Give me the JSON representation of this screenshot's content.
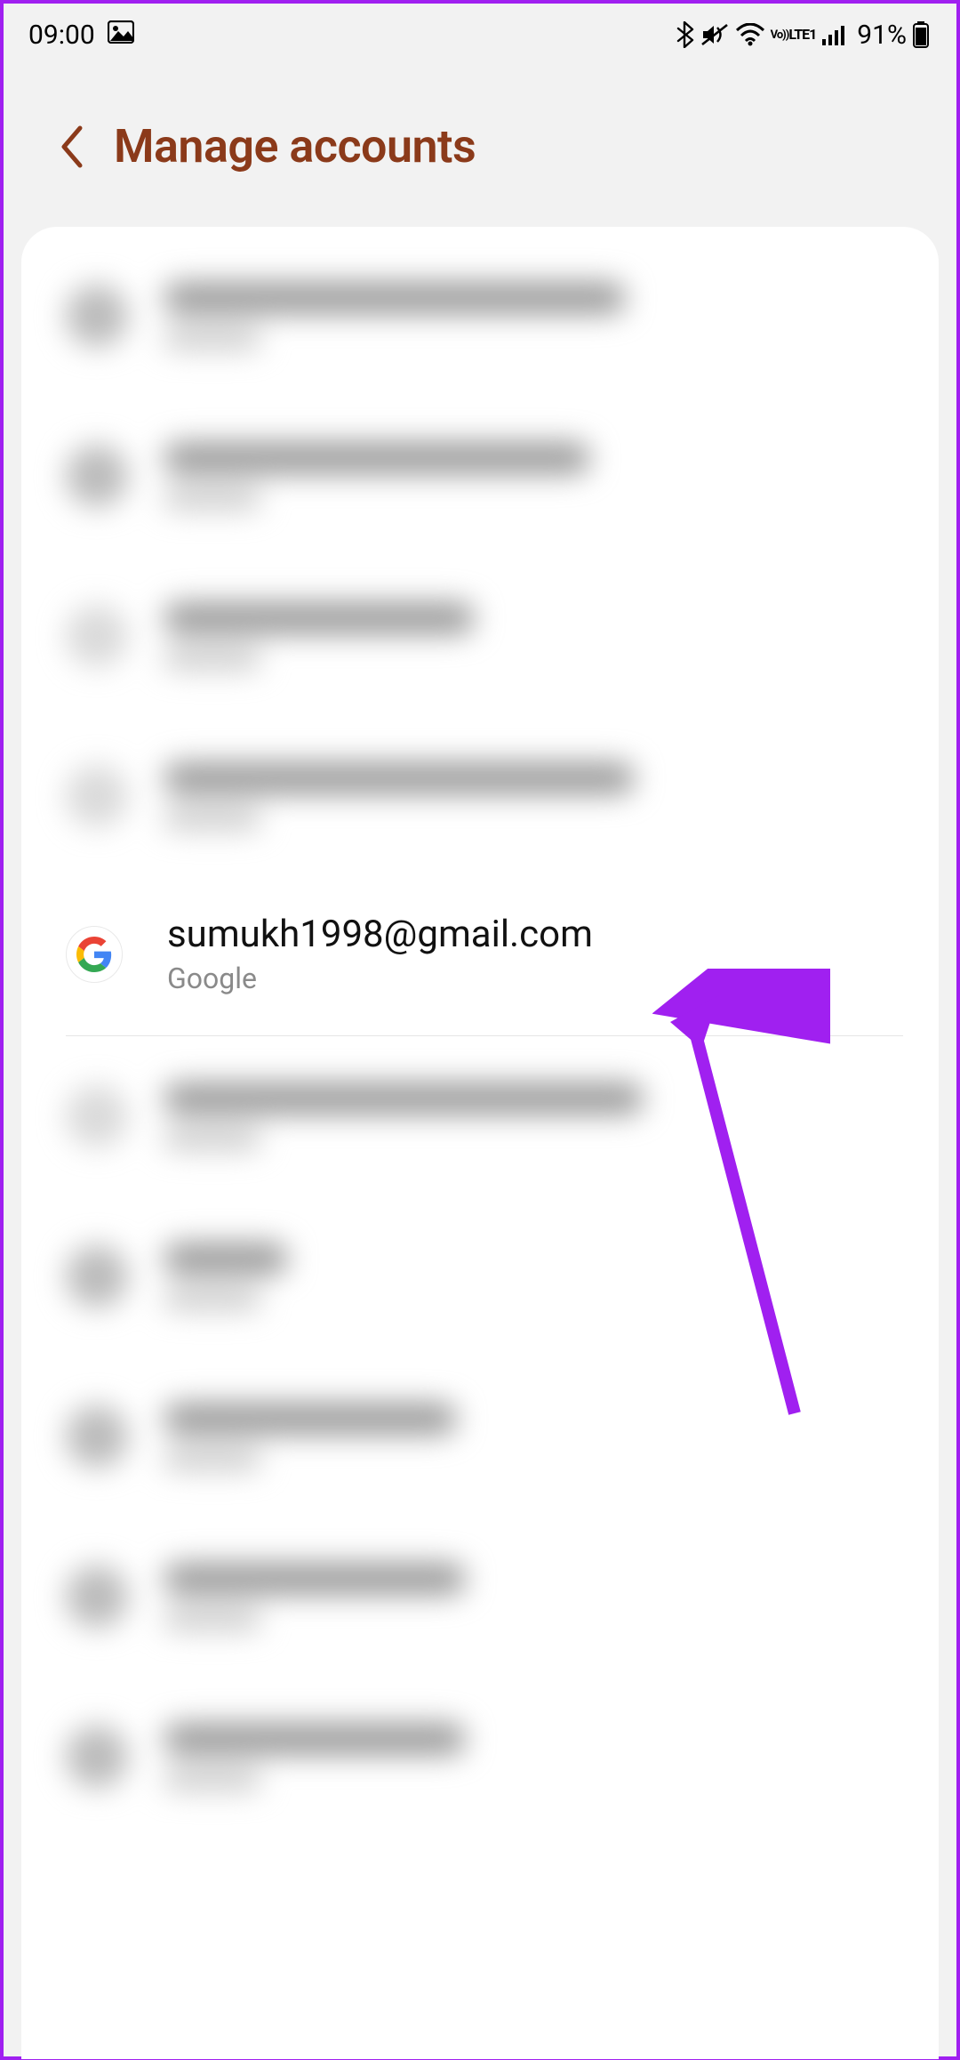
{
  "status_bar": {
    "time": "09:00",
    "battery_percent": "91%",
    "icons": {
      "picture": "picture-icon",
      "bluetooth": "bluetooth-icon",
      "vibrate": "vibrate-mute-icon",
      "wifi": "wifi-icon",
      "volte": "volte-icon",
      "signal": "cell-signal-icon",
      "battery": "battery-icon"
    }
  },
  "header": {
    "title": "Manage accounts"
  },
  "focused_account": {
    "email": "sumukh1998@gmail.com",
    "provider": "Google"
  },
  "annotation": {
    "type": "arrow",
    "color": "#a020f0",
    "target": "focused-account-row"
  }
}
